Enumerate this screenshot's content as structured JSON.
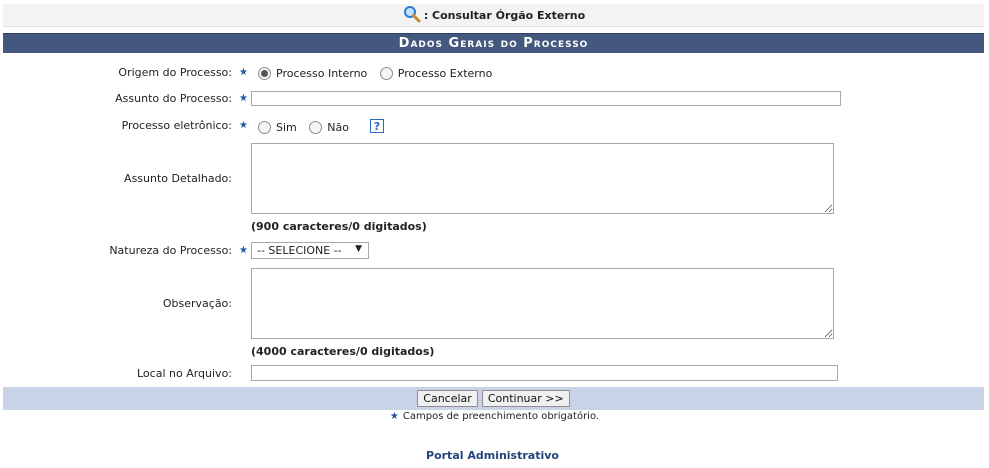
{
  "topbar": {
    "title": ": Consultar Órgão Externo",
    "icon": "magnifier-icon"
  },
  "section_title": "Dados Gerais do Processo",
  "form": {
    "origem": {
      "label": "Origem do Processo:",
      "options": [
        "Processo Interno",
        "Processo Externo"
      ],
      "selected": "Processo Interno"
    },
    "assunto": {
      "label": "Assunto do Processo:",
      "value": ""
    },
    "eletronico": {
      "label": "Processo eletrônico:",
      "options": [
        "Sim",
        "Não"
      ],
      "selected": "",
      "help": "?"
    },
    "detalhado": {
      "label": "Assunto Detalhado:",
      "counter": "(900 caracteres/0 digitados)"
    },
    "natureza": {
      "label": "Natureza do Processo:",
      "selected": "-- SELECIONE --"
    },
    "observacao": {
      "label": "Observação:",
      "counter": "(4000 caracteres/0 digitados)"
    },
    "local": {
      "label": "Local no Arquivo:",
      "value": ""
    }
  },
  "buttons": {
    "cancel": "Cancelar",
    "continue": "Continuar >>"
  },
  "required_note": "Campos de preenchimento obrigatório.",
  "required_star": "★",
  "portal_link": "Portal Administrativo",
  "colors": {
    "header_bg": "#44587d",
    "footer_bg": "#c8d3e8",
    "star": "#2356a3",
    "link": "#23437a"
  }
}
